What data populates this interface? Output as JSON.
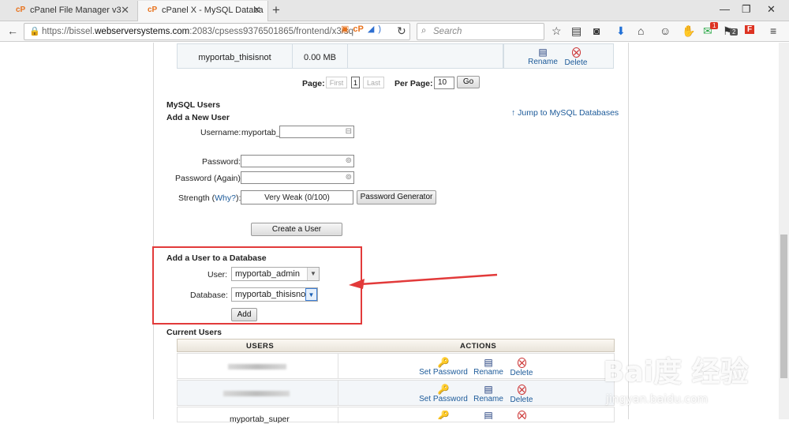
{
  "browser": {
    "tabs": [
      {
        "icon": "cP",
        "title": "cPanel File Manager v3"
      },
      {
        "icon": "cP",
        "title": "cPanel X - MySQL Databa"
      }
    ],
    "url_prefix": "https://bissel.",
    "url_host": "webserversystems.com",
    "url_path": ":2083/cpsess9376501865/frontend/x3/sq",
    "search_placeholder": "Search",
    "notif_count_1": "1",
    "notif_count_2": "2"
  },
  "db_table": {
    "row": {
      "name": "myportab_thisisnot",
      "size": "0.00 MB",
      "rename": "Rename",
      "delete": "Delete"
    }
  },
  "pagination": {
    "page_label": "Page:",
    "first": "First",
    "current": "1",
    "last": "Last",
    "per_page_label": "Per Page:",
    "per_page_value": "10",
    "go": "Go"
  },
  "mysql_users": {
    "section_title": "MySQL Users",
    "jump_link": "Jump to MySQL Databases",
    "add_new_title": "Add a New User",
    "username_label": "Username:",
    "username_prefix": "myportab_",
    "password_label": "Password:",
    "password_again_label": "Password (Again):",
    "strength_label": "Strength (",
    "why_link": "Why?",
    "strength_close": "):",
    "strength_value": "Very Weak (0/100)",
    "password_generator": "Password Generator",
    "create_user": "Create a User"
  },
  "add_user_db": {
    "title": "Add a User to a Database",
    "user_label": "User:",
    "user_value": "myportab_admin",
    "database_label": "Database:",
    "database_value": "myportab_thisisnot",
    "add_button": "Add"
  },
  "current_users": {
    "title": "Current Users",
    "col_users": "USERS",
    "col_actions": "ACTIONS",
    "rows": [
      {
        "user": "",
        "set_password": "Set Password",
        "rename": "Rename",
        "delete": "Delete"
      },
      {
        "user": "",
        "set_password": "Set Password",
        "rename": "Rename",
        "delete": "Delete"
      },
      {
        "user": "myportab_super",
        "set_password": "Set Password",
        "rename": "Rename",
        "delete": "Delete"
      }
    ]
  },
  "watermark": {
    "brand": "Bai度 经验",
    "domain": "jingyan.baidu.com"
  },
  "colors": {
    "link": "#1c5a99",
    "highlight_box": "#e23a3a",
    "arrow": "#e23a3a"
  }
}
